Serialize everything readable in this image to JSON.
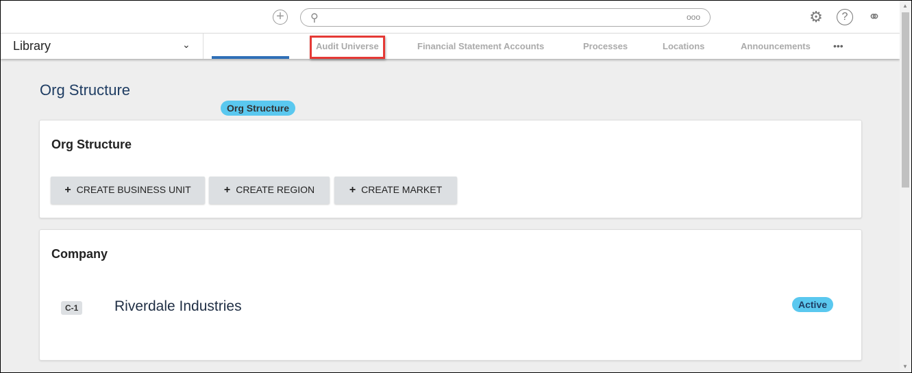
{
  "header": {
    "search_options": "ooo",
    "icons": [
      "plus-circle-icon",
      "search-icon",
      "gear-icon",
      "help-icon",
      "user-icon"
    ]
  },
  "nav": {
    "library_label": "Library",
    "tabs": [
      "Org Structure",
      "Audit Universe",
      "Financial Statement Accounts",
      "Processes",
      "Locations",
      "Announcements"
    ],
    "more": "•••"
  },
  "page": {
    "title": "Org Structure"
  },
  "org_card": {
    "title": "Org Structure",
    "buttons": [
      "CREATE BUSINESS UNIT",
      "CREATE REGION",
      "CREATE MARKET"
    ],
    "plus": "+"
  },
  "company_card": {
    "title": "Company",
    "items": [
      {
        "code": "C-1",
        "name": "Riverdale Industries",
        "status": "Active"
      }
    ]
  },
  "colors": {
    "accent": "#2f6fb7",
    "highlight": "#e53935",
    "status_active": "#5ac8ef"
  }
}
